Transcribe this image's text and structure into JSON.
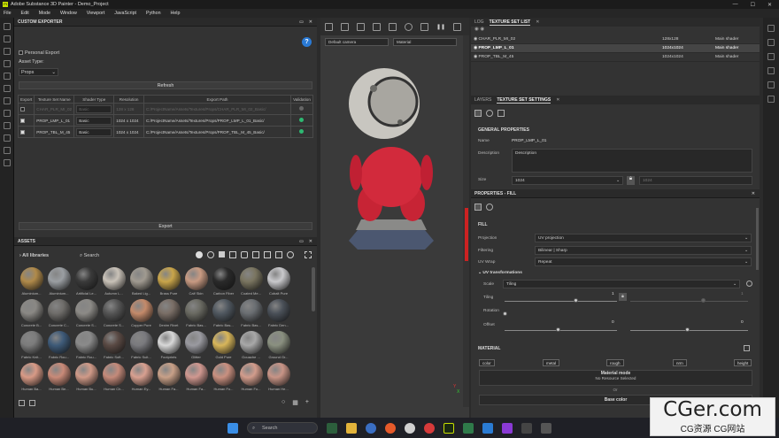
{
  "app": {
    "title": "Adobe Substance 3D Painter - Demo_Project",
    "logo": "Pt"
  },
  "menu": [
    "File",
    "Edit",
    "Mode",
    "Window",
    "Viewport",
    "JavaScript",
    "Python",
    "Help"
  ],
  "exporter": {
    "title": "CUSTOM EXPORTER",
    "personal_export": "Personal Export",
    "asset_type_label": "Asset Type:",
    "asset_type_value": "Props",
    "refresh": "Refresh",
    "columns": [
      "Export",
      "Texture Set Name",
      "Shader Type",
      "Resolution",
      "Export Path",
      "Validation"
    ],
    "rows": [
      {
        "name": "CHAR_PLR_MI_02",
        "shader": "Basic",
        "res": "128 x 128",
        "path": "C:/ProjectName/Assets/Textures/Props/CHAR_PLR_MI_02_Basic/",
        "checked": false,
        "valid": false
      },
      {
        "name": "PROP_LMP_L_01",
        "shader": "Basic",
        "res": "1024 x 1024",
        "path": "C:/ProjectName/Assets/Textures/Props/PROP_LMP_L_01_Basic/",
        "checked": true,
        "valid": true
      },
      {
        "name": "PROP_TBL_M_45",
        "shader": "Basic",
        "res": "1024 x 1024",
        "path": "C:/ProjectName/Assets/Textures/Props/PROP_TBL_M_45_Basic/",
        "checked": true,
        "valid": true
      }
    ],
    "export_btn": "Export"
  },
  "assets": {
    "title": "ASSETS",
    "library": "All libraries",
    "search_placeholder": "Search",
    "items": [
      {
        "label": "Aluminium...",
        "color": "#b08a4a"
      },
      {
        "label": "Aluminium...",
        "color": "#9a9ea2"
      },
      {
        "label": "Artificial Le...",
        "color": "#3a3a3a"
      },
      {
        "label": "Autumn L...",
        "color": "#c9c2b8"
      },
      {
        "label": "Baked Lig...",
        "color": "#a09a90"
      },
      {
        "label": "Brass Pure",
        "color": "#c9a54a"
      },
      {
        "label": "Calf Skin",
        "color": "#c89a82"
      },
      {
        "label": "Carbon Fiber",
        "color": "#2a2a2a"
      },
      {
        "label": "Coated Me...",
        "color": "#7a7560"
      },
      {
        "label": "Cobalt Pure",
        "color": "#c9c9cc"
      },
      {
        "label": "Concrete B...",
        "color": "#8a8884"
      },
      {
        "label": "Concrete C...",
        "color": "#6f6d6a"
      },
      {
        "label": "Concrete S...",
        "color": "#8c8a86"
      },
      {
        "label": "Concrete S...",
        "color": "#555"
      },
      {
        "label": "Copper Pure",
        "color": "#c48a6a"
      },
      {
        "label": "Denim Rivet",
        "color": "#7a6e66"
      },
      {
        "label": "Fabric Bas...",
        "color": "#6a6a62"
      },
      {
        "label": "Fabric Bas...",
        "color": "#505860"
      },
      {
        "label": "Fabric Bas...",
        "color": "#6a6e72"
      },
      {
        "label": "Fabric Den...",
        "color": "#4a5058"
      },
      {
        "label": "Fabric Knit...",
        "color": "#7c7c7c"
      },
      {
        "label": "Fabric Rou...",
        "color": "#3e5a78"
      },
      {
        "label": "Fabric Rou...",
        "color": "#8a8a8a"
      },
      {
        "label": "Fabric Soft...",
        "color": "#5a4a44"
      },
      {
        "label": "Fabric Suit...",
        "color": "#7a7a7e"
      },
      {
        "label": "Footprints",
        "color": "#d8d8d8"
      },
      {
        "label": "Glitter",
        "color": "#9a9aa0"
      },
      {
        "label": "Gold Pure",
        "color": "#d8b65a"
      },
      {
        "label": "Gouache ...",
        "color": "#a8a8a8"
      },
      {
        "label": "Ground Gr...",
        "color": "#8a9080"
      },
      {
        "label": "Human Ba...",
        "color": "#d89a86"
      },
      {
        "label": "Human Be...",
        "color": "#c98a78"
      },
      {
        "label": "Human Bu...",
        "color": "#d09a88"
      },
      {
        "label": "Human Ch...",
        "color": "#c48a7a"
      },
      {
        "label": "Human Ey...",
        "color": "#d8a090"
      },
      {
        "label": "Human Fa...",
        "color": "#c8a088"
      },
      {
        "label": "Human Fa...",
        "color": "#d09890"
      },
      {
        "label": "Human Fo...",
        "color": "#c99080"
      },
      {
        "label": "Human Fo...",
        "color": "#d29c8c"
      },
      {
        "label": "Human He...",
        "color": "#c89486"
      }
    ]
  },
  "viewport": {
    "camera": "Default camera",
    "mode": "Material",
    "axis_labels": [
      "Y",
      "X"
    ]
  },
  "texture_sets": {
    "tabs": [
      "LOG",
      "TEXTURE SET LIST"
    ],
    "rows": [
      {
        "name": "CHAR_PLR_MI_02",
        "size": "128x128",
        "shader": "Main shader"
      },
      {
        "name": "PROP_LMP_L_01",
        "size": "1024x1024",
        "shader": "Main shader"
      },
      {
        "name": "PROP_TBL_M_45",
        "size": "1024x1024",
        "shader": "Main shader"
      }
    ]
  },
  "settings": {
    "tabs": [
      "LAYERS",
      "TEXTURE SET SETTINGS"
    ],
    "section": "GENERAL PROPERTIES",
    "name_label": "Name",
    "name_value": "PROP_LMP_L_01",
    "desc_label": "Description",
    "desc_value": "Description",
    "size_label": "Size",
    "size_value": "1024",
    "size_value2": "1024"
  },
  "fill": {
    "title": "PROPERTIES - FILL",
    "section": "FILL",
    "projection_label": "Projection",
    "projection_value": "UV projection",
    "filtering_label": "Filtering",
    "filtering_value": "Bilinear | Sharp",
    "uvwrap_label": "UV Wrap",
    "uvwrap_value": "Repeat",
    "uvtrans": "UV transformations",
    "scale_label": "Scale",
    "scale_value": "Tiling",
    "tiling_label": "Tiling",
    "tiling_value": "1",
    "tiling_value2": "1",
    "rotation_label": "Rotation",
    "rotation_value": "0",
    "offset_label": "Offset",
    "offset_value": "0",
    "offset_value2": "0"
  },
  "material": {
    "section": "MATERIAL",
    "channels": [
      "color",
      "metal",
      "rough",
      "nrm",
      "height"
    ],
    "mode_title": "Material mode",
    "mode_sub": "No Resource Selected",
    "or": "Or",
    "base_color": "Base color"
  },
  "taskbar": {
    "search": "Search"
  },
  "watermark": {
    "line1": "CGer.com",
    "line2": "CG资源 CG网站"
  }
}
